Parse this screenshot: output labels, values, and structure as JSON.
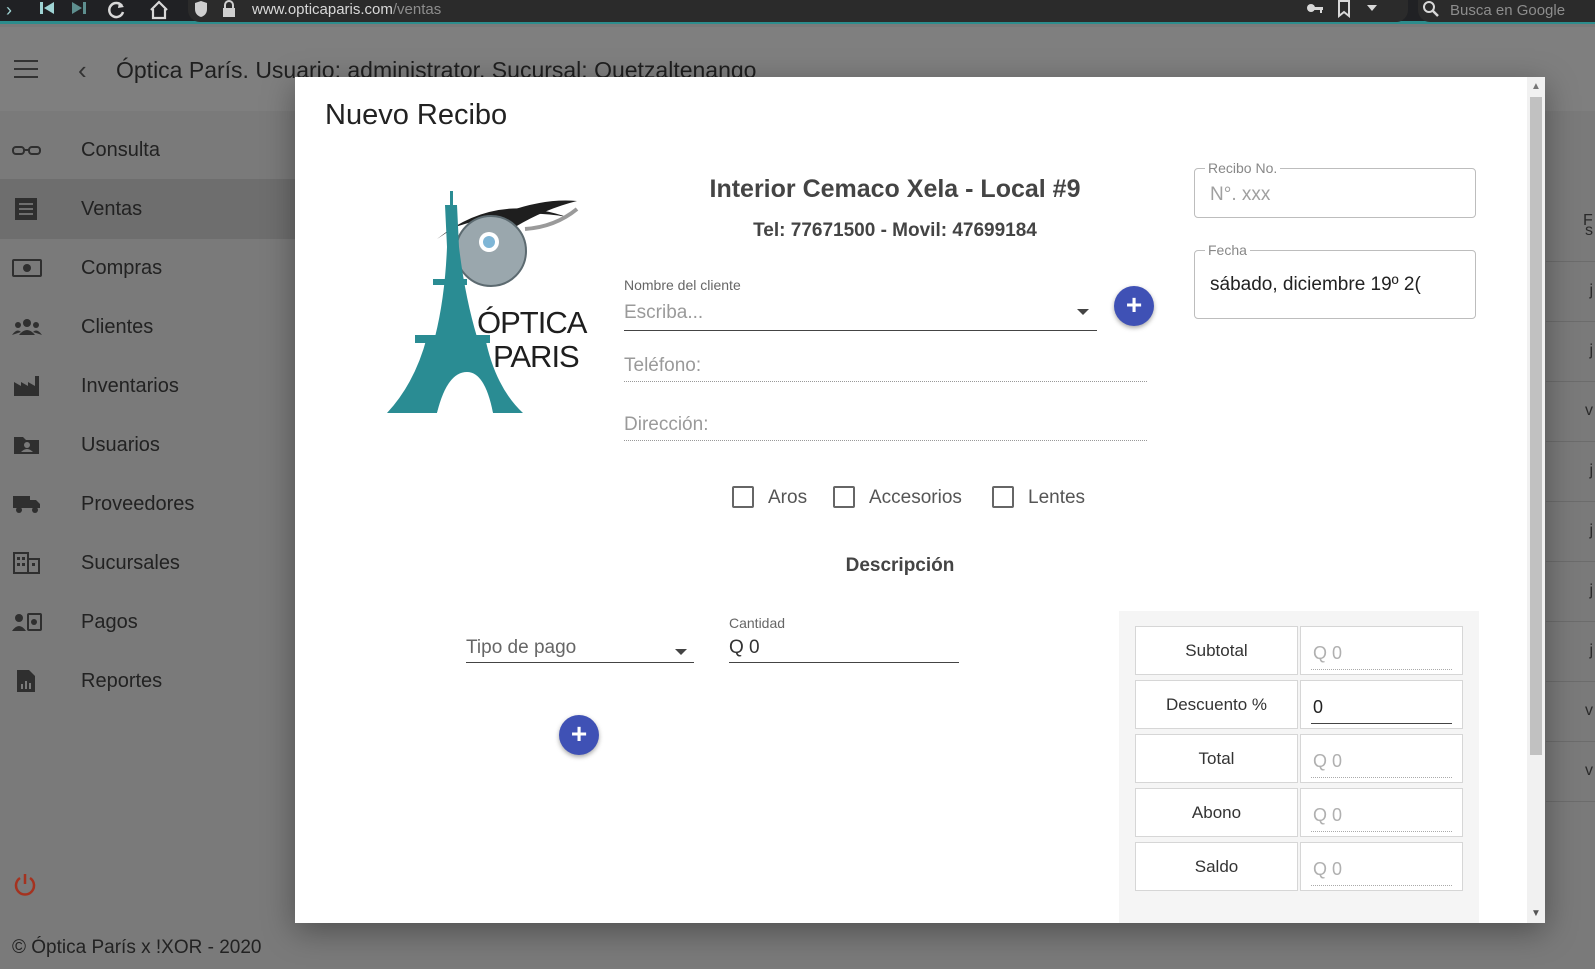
{
  "browser": {
    "url_host": "www.opticaparis.com",
    "url_path": "/ventas",
    "search_placeholder": "Busca en Google"
  },
  "header": {
    "title": "Óptica París. Usuario: administrator. Sucursal: Quetzaltenango"
  },
  "sidebar": {
    "items": [
      {
        "label": "Consulta",
        "icon": "glasses-icon"
      },
      {
        "label": "Ventas",
        "icon": "receipt-icon",
        "active": true
      },
      {
        "label": "Compras",
        "icon": "money-icon"
      },
      {
        "label": "Clientes",
        "icon": "people-icon"
      },
      {
        "label": "Inventarios",
        "icon": "factory-icon"
      },
      {
        "label": "Usuarios",
        "icon": "folder-user-icon"
      },
      {
        "label": "Proveedores",
        "icon": "truck-icon"
      },
      {
        "label": "Sucursales",
        "icon": "building-icon"
      },
      {
        "label": "Pagos",
        "icon": "payment-icon"
      },
      {
        "label": "Reportes",
        "icon": "report-icon"
      }
    ]
  },
  "footer": {
    "text": "© Óptica París x !XOR - 2020"
  },
  "background_table": {
    "cells": [
      "s",
      "j",
      "j",
      "v",
      "j",
      "j",
      "j",
      "j",
      "v",
      "v"
    ],
    "header_cell": "F"
  },
  "modal": {
    "title": "Nuevo Recibo",
    "logo": {
      "line1": "ÓPTICA",
      "line2": "PARIS"
    },
    "store_name": "Interior Cemaco Xela - Local #9",
    "store_tel": "Tel: 77671500 - Movil: 47699184",
    "client": {
      "label": "Nombre del cliente",
      "placeholder": "Escriba..."
    },
    "phone_label": "Teléfono:",
    "address_label": "Dirección:",
    "receipt_no": {
      "legend": "Recibo No.",
      "placeholder": "N°. xxx"
    },
    "date": {
      "legend": "Fecha",
      "value": "sábado, diciembre 19º 2("
    },
    "checkboxes": [
      {
        "label": "Aros",
        "checked": false
      },
      {
        "label": "Accesorios",
        "checked": false
      },
      {
        "label": "Lentes",
        "checked": false
      }
    ],
    "description_title": "Descripción",
    "payment": {
      "type_label": "Tipo de pago",
      "amount_label": "Cantidad",
      "amount_value": "Q 0"
    },
    "totals": {
      "rows": [
        {
          "label": "Subtotal",
          "value": "Q 0",
          "editable": false
        },
        {
          "label": "Descuento %",
          "value": "0",
          "editable": true
        },
        {
          "label": "Total",
          "value": "Q 0",
          "editable": false
        },
        {
          "label": "Abono",
          "value": "Q 0",
          "editable": false
        },
        {
          "label": "Saldo",
          "value": "Q 0",
          "editable": false
        }
      ]
    }
  },
  "colors": {
    "primary": "#3f51b5",
    "logo_teal": "#2a8c93",
    "overlay": "#7a7a7a"
  }
}
